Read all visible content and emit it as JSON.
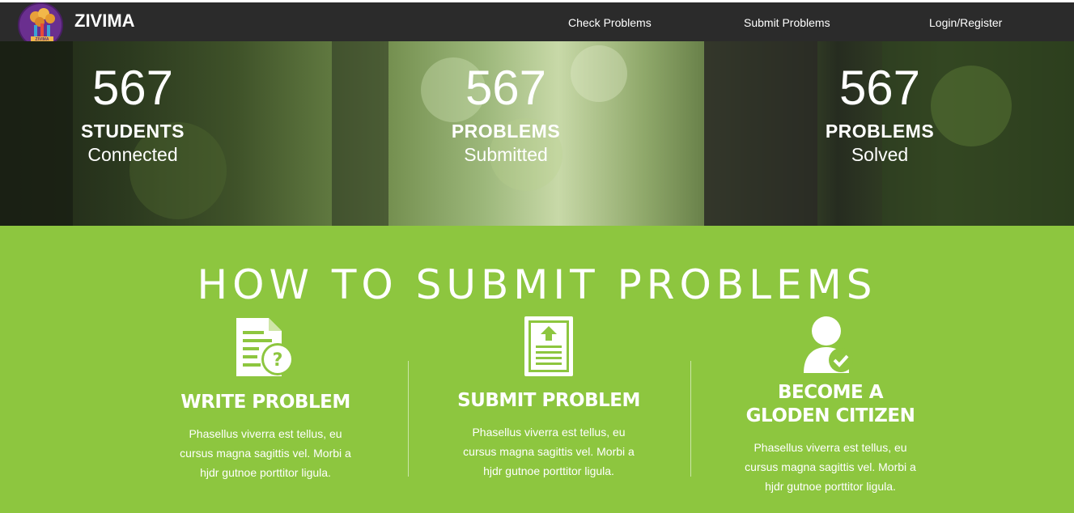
{
  "navbar": {
    "brand": "ZIVIMA",
    "logo_text": "ZIVIMA",
    "links": [
      "Check Problems",
      "Submit Problems",
      "Login/Register"
    ]
  },
  "hero": {
    "stats": [
      {
        "value": "567",
        "title": "STUDENTS",
        "subtitle": "Connected"
      },
      {
        "value": "567",
        "title": "PROBLEMS",
        "subtitle": "Submitted"
      },
      {
        "value": "567",
        "title": "PROBLEMS",
        "subtitle": "Solved"
      }
    ]
  },
  "howto": {
    "title": "HOW TO SUBMIT PROBLEMS",
    "steps": [
      {
        "icon": "document-question-icon",
        "title": "WRITE PROBLEM",
        "text": "Phasellus viverra est tellus, eu cursus magna sagittis vel. Morbi a hjdr gutnoe porttitor ligula."
      },
      {
        "icon": "document-upload-icon",
        "title": "SUBMIT PROBLEM",
        "text": "Phasellus viverra est tellus, eu cursus magna sagittis vel. Morbi a hjdr gutnoe porttitor ligula."
      },
      {
        "icon": "user-check-icon",
        "title_line1": "BECOME A",
        "title_line2": "GLODEN CITIZEN",
        "text": "Phasellus viverra est tellus, eu cursus magna sagittis vel. Morbi a hjdr gutnoe porttitor ligula."
      }
    ]
  },
  "colors": {
    "navbar": "#2b2b2b",
    "section_green": "#8dc63f",
    "text": "#ffffff",
    "logo": "#6a2f8f"
  }
}
